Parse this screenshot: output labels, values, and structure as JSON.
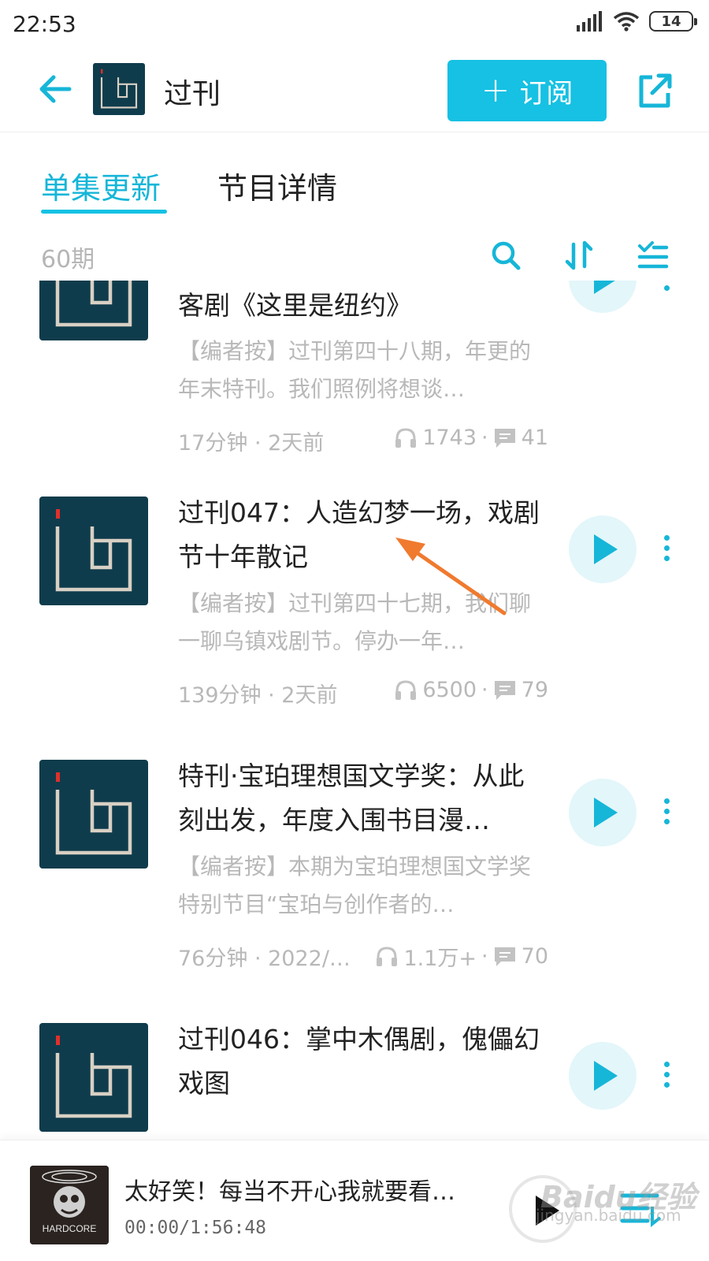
{
  "status_bar": {
    "time": "22:53",
    "battery": "14"
  },
  "header": {
    "title": "过刊",
    "subscribe_label": "订阅"
  },
  "tabs": [
    {
      "label": "单集更新",
      "active": true
    },
    {
      "label": "节目详情",
      "active": false
    }
  ],
  "toolbar": {
    "episode_count": "60期"
  },
  "episodes": [
    {
      "title": "客剧《这里是纽约》",
      "description": "【编者按】过刊第四十八期，年更的年末特刊。我们照例将想谈…",
      "duration": "17分钟",
      "published": "2天前",
      "plays": "1743",
      "comments": "41"
    },
    {
      "title": "过刊047：人造幻梦一场，戏剧节十年散记",
      "description": "【编者按】过刊第四十七期，我们聊一聊乌镇戏剧节。停办一年…",
      "duration": "139分钟",
      "published": "2天前",
      "plays": "6500",
      "comments": "79"
    },
    {
      "title": "特刊·宝珀理想国文学奖：从此刻出发，年度入围书目漫…",
      "description": "【编者按】本期为宝珀理想国文学奖特别节目“宝珀与创作者的…",
      "duration": "76分钟",
      "published": "2022/…",
      "plays": "1.1万+",
      "comments": "70"
    },
    {
      "title": "过刊046：掌中木偶剧，傀儡幻戏图",
      "description": "",
      "duration": "",
      "published": "",
      "plays": "",
      "comments": ""
    }
  ],
  "player": {
    "title": "太好笑！每当不开心我就要看…",
    "time": "00:00/1:56:48",
    "cover_text": "HARDCORE"
  },
  "watermark": {
    "brand": "Baidu经验",
    "url": "jingyan.baidu.com"
  },
  "colors": {
    "accent": "#16c1e3",
    "cover_bg": "#0f3c4c",
    "annotation_arrow": "#f07a2e"
  }
}
